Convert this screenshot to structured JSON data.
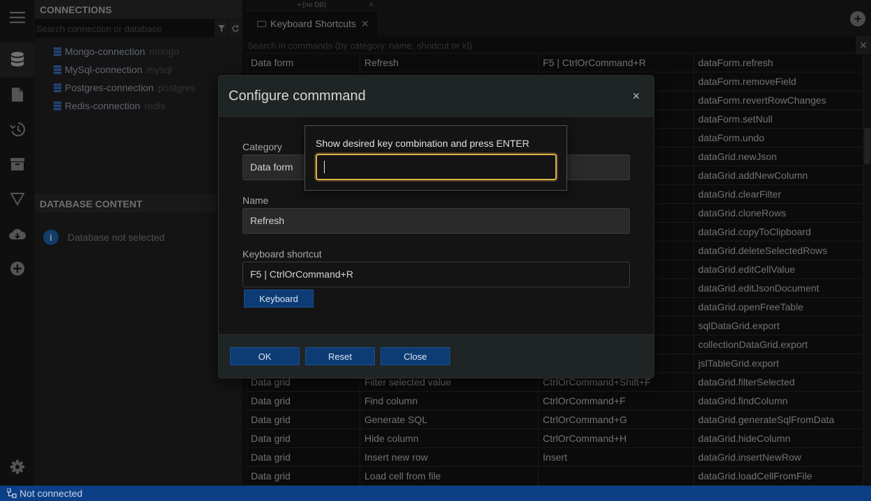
{
  "connections_panel": {
    "title": "CONNECTIONS",
    "search_placeholder": "Search connection or database",
    "filter_icon": "filter-icon",
    "refresh_icon": "refresh-icon",
    "items": [
      {
        "name": "Mongo-connection",
        "type": "mongo"
      },
      {
        "name": "MySql-connection",
        "type": "mysql"
      },
      {
        "name": "Postgres-connection",
        "type": "postgres"
      },
      {
        "name": "Redis-connection",
        "type": "redis"
      }
    ]
  },
  "database_content": {
    "title": "DATABASE CONTENT",
    "message": "Database not selected"
  },
  "iconbar": [
    "menu-icon",
    "database-icon",
    "file-icon",
    "history-icon",
    "archive-icon",
    "filter-icon",
    "cloud-icon",
    "add-circle-icon",
    "settings-icon"
  ],
  "tabs": {
    "db_label": "(no DB)",
    "active": "Keyboard Shortcuts",
    "close": "✕",
    "add": "+"
  },
  "commands": {
    "search_placeholder": "Search in commands (by category, name, shortcut or id)",
    "clear": "✕",
    "rows": [
      [
        "Data form",
        "Refresh",
        "F5 | CtrlOrCommand+R",
        "dataForm.refresh"
      ],
      [
        "",
        "",
        "",
        "dataForm.removeField"
      ],
      [
        "",
        "",
        "",
        "dataForm.revertRowChanges"
      ],
      [
        "",
        "",
        "",
        "dataForm.setNull"
      ],
      [
        "",
        "",
        "",
        "dataForm.undo"
      ],
      [
        "",
        "",
        "",
        "dataGrid.newJson"
      ],
      [
        "",
        "",
        "",
        "dataGrid.addNewColumn"
      ],
      [
        "",
        "",
        "",
        "dataGrid.clearFilter"
      ],
      [
        "",
        "",
        "",
        "dataGrid.cloneRows"
      ],
      [
        "",
        "",
        "",
        "dataGrid.copyToClipboard"
      ],
      [
        "",
        "",
        "",
        "dataGrid.deleteSelectedRows"
      ],
      [
        "",
        "",
        "",
        "dataGrid.editCellValue"
      ],
      [
        "",
        "",
        "",
        "dataGrid.editJsonDocument"
      ],
      [
        "",
        "",
        "",
        "dataGrid.openFreeTable"
      ],
      [
        "",
        "",
        "",
        "sqlDataGrid.export"
      ],
      [
        "",
        "",
        "",
        "collectionDataGrid.export"
      ],
      [
        "",
        "",
        "",
        "jslTableGrid.export"
      ],
      [
        "Data grid",
        "Filter selected value",
        "CtrlOrCommand+Shift+F",
        "dataGrid.filterSelected"
      ],
      [
        "Data grid",
        "Find column",
        "CtrlOrCommand+F",
        "dataGrid.findColumn"
      ],
      [
        "Data grid",
        "Generate SQL",
        "CtrlOrCommand+G",
        "dataGrid.generateSqlFromData"
      ],
      [
        "Data grid",
        "Hide column",
        "CtrlOrCommand+H",
        "dataGrid.hideColumn"
      ],
      [
        "Data grid",
        "Insert new row",
        "Insert",
        "dataGrid.insertNewRow"
      ],
      [
        "Data grid",
        "Load cell from file",
        "",
        "dataGrid.loadCellFromFile"
      ]
    ]
  },
  "modal": {
    "title": "Configure commmand",
    "close": "×",
    "category_label": "Category",
    "category_value": "Data form",
    "name_label": "Name",
    "name_value": "Refresh",
    "shortcut_label": "Keyboard shortcut",
    "shortcut_value": "F5 | CtrlOrCommand+R",
    "keyboard_button": "Keyboard",
    "ok": "OK",
    "reset": "Reset",
    "close_button": "Close"
  },
  "key_popup": {
    "prompt": "Show desired key combination and press ENTER",
    "value": ""
  },
  "statusbar": {
    "text": "Not connected"
  },
  "colors": {
    "accent": "#0c3f86",
    "button": "#0d3b73",
    "focus": "#e0b24a",
    "info": "#1f6fbf"
  }
}
